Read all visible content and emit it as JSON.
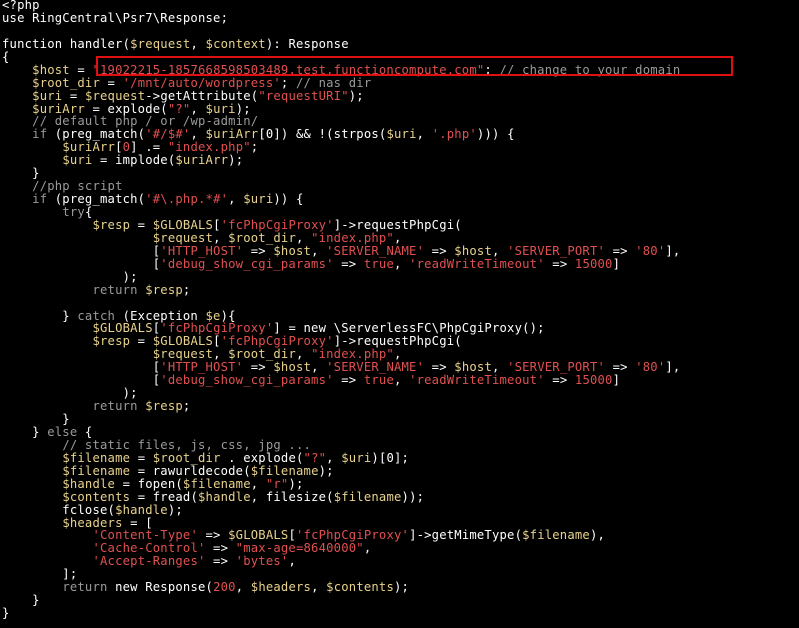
{
  "colors": {
    "background": "#000000",
    "default": "#ffffff",
    "variable": "#e8d28c",
    "string": "#e05050",
    "comment": "#9a9a9a",
    "highlight_box": "#e01010"
  },
  "code_lines": [
    [
      {
        "t": "default",
        "s": "<?php"
      }
    ],
    [
      {
        "t": "default",
        "s": "use RingCentral\\Psr7\\Response;"
      }
    ],
    [
      {
        "t": "default",
        "s": ""
      }
    ],
    [
      {
        "t": "default",
        "s": "function handler("
      },
      {
        "t": "variable",
        "s": "$request"
      },
      {
        "t": "default",
        "s": ", "
      },
      {
        "t": "variable",
        "s": "$context"
      },
      {
        "t": "default",
        "s": "): Response"
      }
    ],
    [
      {
        "t": "default",
        "s": "{"
      }
    ],
    [
      {
        "t": "default",
        "s": "    "
      },
      {
        "t": "variable",
        "s": "$host"
      },
      {
        "t": "default",
        "s": " = "
      },
      {
        "t": "string",
        "s": "\"19022215-1857668598503489.test.functioncompute.com\""
      },
      {
        "t": "default",
        "s": "; "
      },
      {
        "t": "comment",
        "s": "// change to your domain"
      }
    ],
    [
      {
        "t": "default",
        "s": "    "
      },
      {
        "t": "variable",
        "s": "$root_dir"
      },
      {
        "t": "default",
        "s": " = "
      },
      {
        "t": "string",
        "s": "'/mnt/auto/wordpress'"
      },
      {
        "t": "default",
        "s": "; "
      },
      {
        "t": "comment",
        "s": "// nas dir"
      }
    ],
    [
      {
        "t": "default",
        "s": "    "
      },
      {
        "t": "variable",
        "s": "$uri"
      },
      {
        "t": "default",
        "s": " = "
      },
      {
        "t": "variable",
        "s": "$request"
      },
      {
        "t": "default",
        "s": "->getAttribute("
      },
      {
        "t": "string",
        "s": "\"requestURI\""
      },
      {
        "t": "default",
        "s": ");"
      }
    ],
    [
      {
        "t": "default",
        "s": "    "
      },
      {
        "t": "variable",
        "s": "$uriArr"
      },
      {
        "t": "default",
        "s": " = explode("
      },
      {
        "t": "string",
        "s": "\"?\""
      },
      {
        "t": "default",
        "s": ", "
      },
      {
        "t": "variable",
        "s": "$uri"
      },
      {
        "t": "default",
        "s": ");"
      }
    ],
    [
      {
        "t": "default",
        "s": "    "
      },
      {
        "t": "comment",
        "s": "// default php / or /wp-admin/"
      }
    ],
    [
      {
        "t": "default",
        "s": "    "
      },
      {
        "t": "comment",
        "s": "if"
      },
      {
        "t": "default",
        "s": " (preg_match("
      },
      {
        "t": "string",
        "s": "'#/$#'"
      },
      {
        "t": "default",
        "s": ", "
      },
      {
        "t": "variable",
        "s": "$uriArr"
      },
      {
        "t": "default",
        "s": "[0]) && !(strpos("
      },
      {
        "t": "variable",
        "s": "$uri"
      },
      {
        "t": "default",
        "s": ", "
      },
      {
        "t": "string",
        "s": "'.php'"
      },
      {
        "t": "default",
        "s": "))) {"
      }
    ],
    [
      {
        "t": "default",
        "s": "        "
      },
      {
        "t": "variable",
        "s": "$uriArr"
      },
      {
        "t": "default",
        "s": "["
      },
      {
        "t": "string",
        "s": "0"
      },
      {
        "t": "default",
        "s": "] .= "
      },
      {
        "t": "string",
        "s": "\"index.php\""
      },
      {
        "t": "default",
        "s": ";"
      }
    ],
    [
      {
        "t": "default",
        "s": "        "
      },
      {
        "t": "variable",
        "s": "$uri"
      },
      {
        "t": "default",
        "s": " = implode("
      },
      {
        "t": "variable",
        "s": "$uriArr"
      },
      {
        "t": "default",
        "s": ");"
      }
    ],
    [
      {
        "t": "default",
        "s": "    }"
      }
    ],
    [
      {
        "t": "default",
        "s": "    "
      },
      {
        "t": "comment",
        "s": "//php script"
      }
    ],
    [
      {
        "t": "default",
        "s": "    "
      },
      {
        "t": "comment",
        "s": "if"
      },
      {
        "t": "default",
        "s": " (preg_match("
      },
      {
        "t": "string",
        "s": "'#\\.php.*#'"
      },
      {
        "t": "default",
        "s": ", "
      },
      {
        "t": "variable",
        "s": "$uri"
      },
      {
        "t": "default",
        "s": ")) {"
      }
    ],
    [
      {
        "t": "default",
        "s": "        "
      },
      {
        "t": "comment",
        "s": "try"
      },
      {
        "t": "default",
        "s": "{"
      }
    ],
    [
      {
        "t": "default",
        "s": "            "
      },
      {
        "t": "variable",
        "s": "$resp"
      },
      {
        "t": "default",
        "s": " = "
      },
      {
        "t": "variable",
        "s": "$GLOBALS"
      },
      {
        "t": "default",
        "s": "["
      },
      {
        "t": "string",
        "s": "'fcPhpCgiProxy'"
      },
      {
        "t": "default",
        "s": "]->requestPhpCgi("
      }
    ],
    [
      {
        "t": "default",
        "s": "                    "
      },
      {
        "t": "variable",
        "s": "$request"
      },
      {
        "t": "default",
        "s": ", "
      },
      {
        "t": "variable",
        "s": "$root_dir"
      },
      {
        "t": "default",
        "s": ", "
      },
      {
        "t": "string",
        "s": "\"index.php\""
      },
      {
        "t": "default",
        "s": ","
      }
    ],
    [
      {
        "t": "default",
        "s": "                    ["
      },
      {
        "t": "string",
        "s": "'HTTP_HOST'"
      },
      {
        "t": "default",
        "s": " => "
      },
      {
        "t": "variable",
        "s": "$host"
      },
      {
        "t": "default",
        "s": ", "
      },
      {
        "t": "string",
        "s": "'SERVER_NAME'"
      },
      {
        "t": "default",
        "s": " => "
      },
      {
        "t": "variable",
        "s": "$host"
      },
      {
        "t": "default",
        "s": ", "
      },
      {
        "t": "string",
        "s": "'SERVER_PORT'"
      },
      {
        "t": "default",
        "s": " => "
      },
      {
        "t": "string",
        "s": "'80'"
      },
      {
        "t": "default",
        "s": "],"
      }
    ],
    [
      {
        "t": "default",
        "s": "                    ["
      },
      {
        "t": "string",
        "s": "'debug_show_cgi_params'"
      },
      {
        "t": "default",
        "s": " => "
      },
      {
        "t": "string",
        "s": "true"
      },
      {
        "t": "default",
        "s": ", "
      },
      {
        "t": "string",
        "s": "'readWriteTimeout'"
      },
      {
        "t": "default",
        "s": " => "
      },
      {
        "t": "string",
        "s": "15000"
      },
      {
        "t": "default",
        "s": "]"
      }
    ],
    [
      {
        "t": "default",
        "s": "                );"
      }
    ],
    [
      {
        "t": "default",
        "s": "            "
      },
      {
        "t": "comment",
        "s": "return"
      },
      {
        "t": "default",
        "s": " "
      },
      {
        "t": "variable",
        "s": "$resp"
      },
      {
        "t": "default",
        "s": ";"
      }
    ],
    [
      {
        "t": "default",
        "s": ""
      }
    ],
    [
      {
        "t": "default",
        "s": "        } "
      },
      {
        "t": "comment",
        "s": "catch"
      },
      {
        "t": "default",
        "s": " (Exception "
      },
      {
        "t": "variable",
        "s": "$e"
      },
      {
        "t": "default",
        "s": "){"
      }
    ],
    [
      {
        "t": "default",
        "s": "            "
      },
      {
        "t": "variable",
        "s": "$GLOBALS"
      },
      {
        "t": "default",
        "s": "["
      },
      {
        "t": "string",
        "s": "'fcPhpCgiProxy'"
      },
      {
        "t": "default",
        "s": "] = new \\ServerlessFC\\PhpCgiProxy();"
      }
    ],
    [
      {
        "t": "default",
        "s": "            "
      },
      {
        "t": "variable",
        "s": "$resp"
      },
      {
        "t": "default",
        "s": " = "
      },
      {
        "t": "variable",
        "s": "$GLOBALS"
      },
      {
        "t": "default",
        "s": "["
      },
      {
        "t": "string",
        "s": "'fcPhpCgiProxy'"
      },
      {
        "t": "default",
        "s": "]->requestPhpCgi("
      }
    ],
    [
      {
        "t": "default",
        "s": "                    "
      },
      {
        "t": "variable",
        "s": "$request"
      },
      {
        "t": "default",
        "s": ", "
      },
      {
        "t": "variable",
        "s": "$root_dir"
      },
      {
        "t": "default",
        "s": ", "
      },
      {
        "t": "string",
        "s": "\"index.php\""
      },
      {
        "t": "default",
        "s": ","
      }
    ],
    [
      {
        "t": "default",
        "s": "                    ["
      },
      {
        "t": "string",
        "s": "'HTTP_HOST'"
      },
      {
        "t": "default",
        "s": " => "
      },
      {
        "t": "variable",
        "s": "$host"
      },
      {
        "t": "default",
        "s": ", "
      },
      {
        "t": "string",
        "s": "'SERVER_NAME'"
      },
      {
        "t": "default",
        "s": " => "
      },
      {
        "t": "variable",
        "s": "$host"
      },
      {
        "t": "default",
        "s": ", "
      },
      {
        "t": "string",
        "s": "'SERVER_PORT'"
      },
      {
        "t": "default",
        "s": " => "
      },
      {
        "t": "string",
        "s": "'80'"
      },
      {
        "t": "default",
        "s": "],"
      }
    ],
    [
      {
        "t": "default",
        "s": "                    ["
      },
      {
        "t": "string",
        "s": "'debug_show_cgi_params'"
      },
      {
        "t": "default",
        "s": " => "
      },
      {
        "t": "string",
        "s": "true"
      },
      {
        "t": "default",
        "s": ", "
      },
      {
        "t": "string",
        "s": "'readWriteTimeout'"
      },
      {
        "t": "default",
        "s": " => "
      },
      {
        "t": "string",
        "s": "15000"
      },
      {
        "t": "default",
        "s": "]"
      }
    ],
    [
      {
        "t": "default",
        "s": "                );"
      }
    ],
    [
      {
        "t": "default",
        "s": "            "
      },
      {
        "t": "comment",
        "s": "return"
      },
      {
        "t": "default",
        "s": " "
      },
      {
        "t": "variable",
        "s": "$resp"
      },
      {
        "t": "default",
        "s": ";"
      }
    ],
    [
      {
        "t": "default",
        "s": "        }"
      }
    ],
    [
      {
        "t": "default",
        "s": "    } "
      },
      {
        "t": "comment",
        "s": "else"
      },
      {
        "t": "default",
        "s": " {"
      }
    ],
    [
      {
        "t": "default",
        "s": "        "
      },
      {
        "t": "comment",
        "s": "// static files, js, css, jpg ..."
      }
    ],
    [
      {
        "t": "default",
        "s": "        "
      },
      {
        "t": "variable",
        "s": "$filename"
      },
      {
        "t": "default",
        "s": " = "
      },
      {
        "t": "variable",
        "s": "$root_dir"
      },
      {
        "t": "default",
        "s": " . explode("
      },
      {
        "t": "string",
        "s": "\"?\""
      },
      {
        "t": "default",
        "s": ", "
      },
      {
        "t": "variable",
        "s": "$uri"
      },
      {
        "t": "default",
        "s": ")[0];"
      }
    ],
    [
      {
        "t": "default",
        "s": "        "
      },
      {
        "t": "variable",
        "s": "$filename"
      },
      {
        "t": "default",
        "s": " = rawurldecode("
      },
      {
        "t": "variable",
        "s": "$filename"
      },
      {
        "t": "default",
        "s": ");"
      }
    ],
    [
      {
        "t": "default",
        "s": "        "
      },
      {
        "t": "variable",
        "s": "$handle"
      },
      {
        "t": "default",
        "s": " = fopen("
      },
      {
        "t": "variable",
        "s": "$filename"
      },
      {
        "t": "default",
        "s": ", "
      },
      {
        "t": "string",
        "s": "\"r\""
      },
      {
        "t": "default",
        "s": ");"
      }
    ],
    [
      {
        "t": "default",
        "s": "        "
      },
      {
        "t": "variable",
        "s": "$contents"
      },
      {
        "t": "default",
        "s": " = fread("
      },
      {
        "t": "variable",
        "s": "$handle"
      },
      {
        "t": "default",
        "s": ", filesize("
      },
      {
        "t": "variable",
        "s": "$filename"
      },
      {
        "t": "default",
        "s": "));"
      }
    ],
    [
      {
        "t": "default",
        "s": "        fclose("
      },
      {
        "t": "variable",
        "s": "$handle"
      },
      {
        "t": "default",
        "s": ");"
      }
    ],
    [
      {
        "t": "default",
        "s": "        "
      },
      {
        "t": "variable",
        "s": "$headers"
      },
      {
        "t": "default",
        "s": " = ["
      }
    ],
    [
      {
        "t": "default",
        "s": "            "
      },
      {
        "t": "string",
        "s": "'Content-Type'"
      },
      {
        "t": "default",
        "s": " => "
      },
      {
        "t": "variable",
        "s": "$GLOBALS"
      },
      {
        "t": "default",
        "s": "["
      },
      {
        "t": "string",
        "s": "'fcPhpCgiProxy'"
      },
      {
        "t": "default",
        "s": "]->getMimeType("
      },
      {
        "t": "variable",
        "s": "$filename"
      },
      {
        "t": "default",
        "s": "),"
      }
    ],
    [
      {
        "t": "default",
        "s": "            "
      },
      {
        "t": "string",
        "s": "'Cache-Control'"
      },
      {
        "t": "default",
        "s": " => "
      },
      {
        "t": "string",
        "s": "\"max-age=8640000\""
      },
      {
        "t": "default",
        "s": ","
      }
    ],
    [
      {
        "t": "default",
        "s": "            "
      },
      {
        "t": "string",
        "s": "'Accept-Ranges'"
      },
      {
        "t": "default",
        "s": " => "
      },
      {
        "t": "string",
        "s": "'bytes'"
      },
      {
        "t": "default",
        "s": ","
      }
    ],
    [
      {
        "t": "default",
        "s": "        ];"
      }
    ],
    [
      {
        "t": "default",
        "s": "        "
      },
      {
        "t": "comment",
        "s": "return"
      },
      {
        "t": "default",
        "s": " new Response("
      },
      {
        "t": "string",
        "s": "200"
      },
      {
        "t": "default",
        "s": ", "
      },
      {
        "t": "variable",
        "s": "$headers"
      },
      {
        "t": "default",
        "s": ", "
      },
      {
        "t": "variable",
        "s": "$contents"
      },
      {
        "t": "default",
        "s": ");"
      }
    ],
    [
      {
        "t": "default",
        "s": "    }"
      }
    ],
    [
      {
        "t": "default",
        "s": "}"
      }
    ]
  ]
}
